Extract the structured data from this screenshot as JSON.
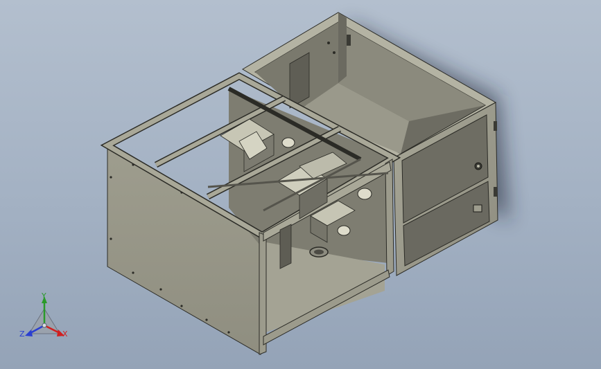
{
  "triad": {
    "y_label": "Y",
    "z_label": "Z",
    "x_label": "X",
    "y_color": "#2a9a2a",
    "z_color": "#2a3fd0",
    "x_color": "#d02020"
  },
  "colors": {
    "background_top": "#b3bfce",
    "background_bottom": "#94a3b7",
    "panel_light": "#b9b8a8",
    "panel_mid": "#a09f90",
    "panel_dark": "#7f7e72",
    "edge": "#2b2b26"
  }
}
